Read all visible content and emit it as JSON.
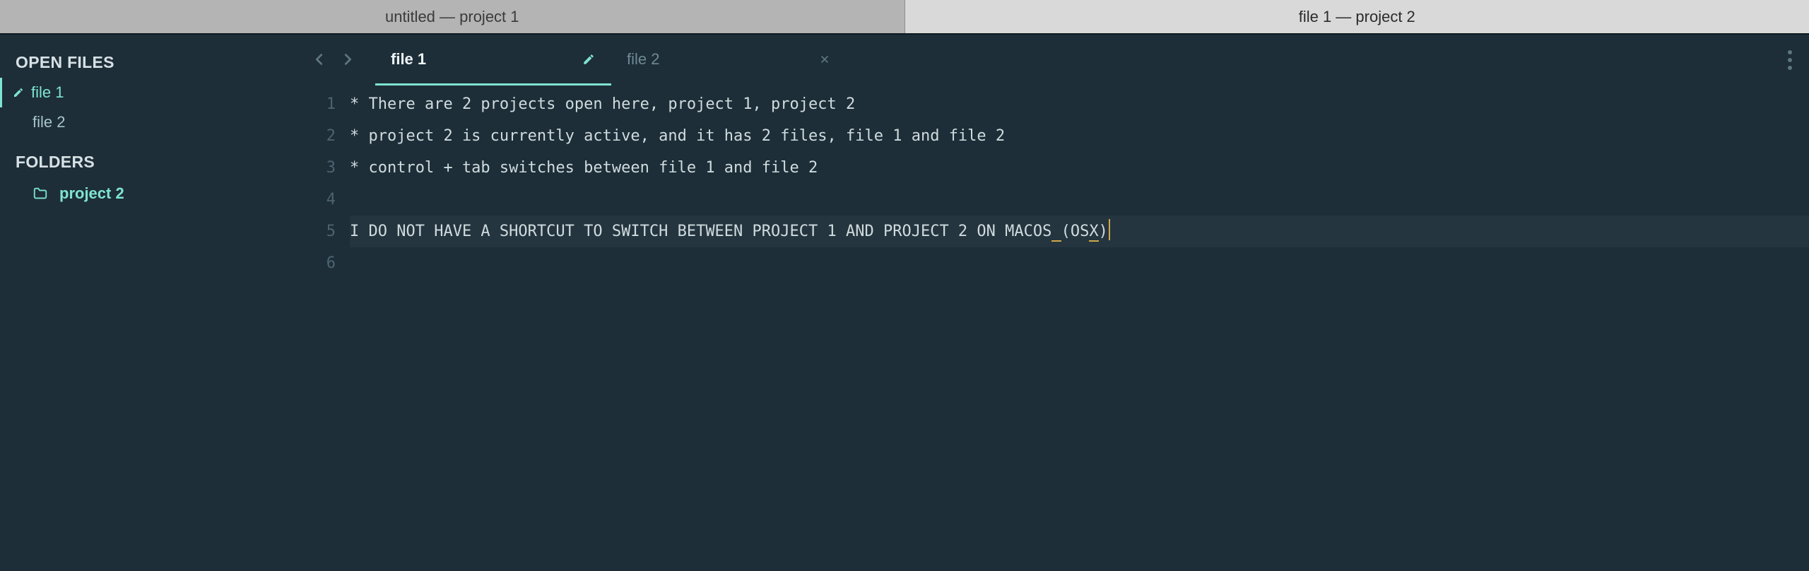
{
  "project_tabs": [
    {
      "label": "untitled — project 1",
      "active": false
    },
    {
      "label": "file 1 — project 2",
      "active": true
    }
  ],
  "sidebar": {
    "open_files_header": "OPEN FILES",
    "open_files": [
      {
        "label": "file 1",
        "active": true,
        "dirty": true
      },
      {
        "label": "file 2",
        "active": false,
        "dirty": false
      }
    ],
    "folders_header": "FOLDERS",
    "folders": [
      {
        "label": "project 2"
      }
    ]
  },
  "file_tabs": [
    {
      "label": "file 1",
      "active": true,
      "dirty": true
    },
    {
      "label": "file 2",
      "active": false,
      "dirty": false
    }
  ],
  "editor": {
    "lines": [
      "* There are 2 projects open here, project 1, project 2",
      "* project 2 is currently active, and it has 2 files, file 1 and file 2",
      "* control + tab switches between file 1 and file 2",
      "",
      "I DO NOT HAVE A SHORTCUT TO SWITCH BETWEEN PROJECT 1 AND PROJECT 2 ON MACOS (OSX)",
      ""
    ],
    "current_line_index": 4,
    "bracket_underline": {
      "line": 4,
      "open_col": 75,
      "close_col": 79
    }
  }
}
